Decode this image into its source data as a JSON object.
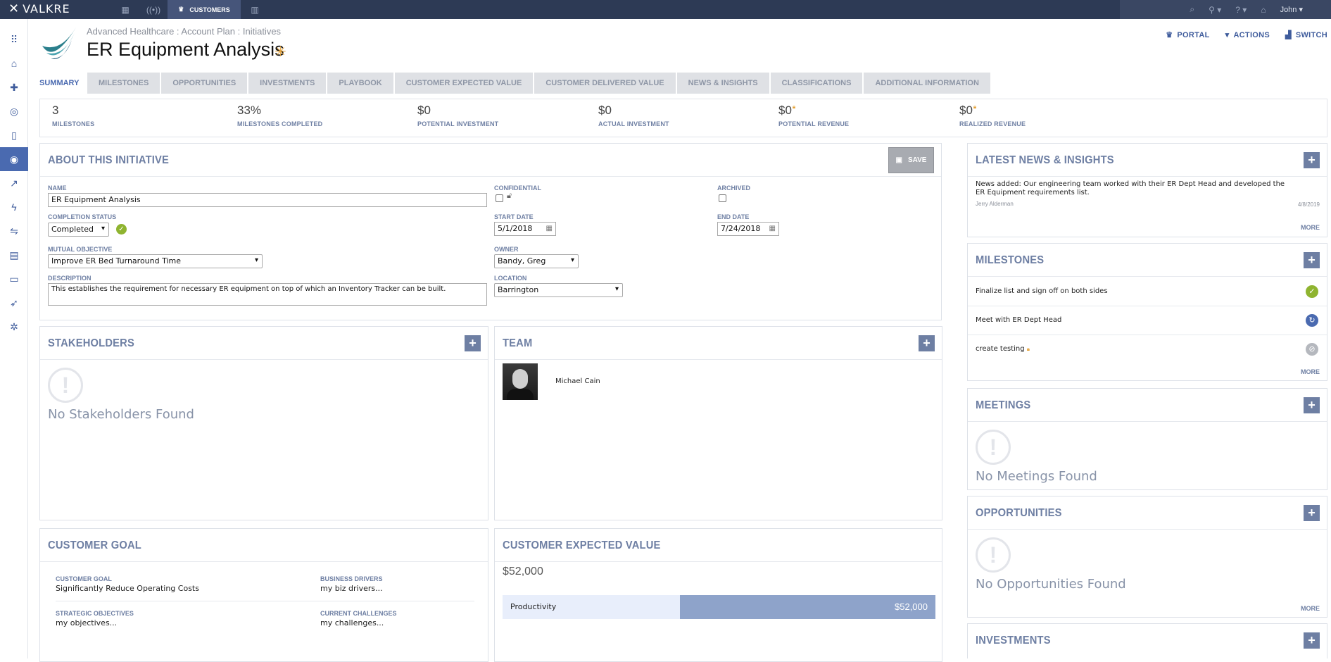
{
  "topbar": {
    "brand": "VALKRE",
    "active_nav": "CUSTOMERS",
    "user": "John"
  },
  "header": {
    "breadcrumb": "Advanced Healthcare : Account Plan : Initiatives",
    "title": "ER Equipment Analysis",
    "actions": [
      "PORTAL",
      "ACTIONS",
      "SWITCH"
    ]
  },
  "tabs": [
    "SUMMARY",
    "MILESTONES",
    "OPPORTUNITIES",
    "INVESTMENTS",
    "PLAYBOOK",
    "CUSTOMER EXPECTED VALUE",
    "CUSTOMER DELIVERED VALUE",
    "NEWS & INSIGHTS",
    "CLASSIFICATIONS",
    "ADDITIONAL INFORMATION"
  ],
  "stats": [
    {
      "value": "3",
      "label": "MILESTONES"
    },
    {
      "value": "33%",
      "label": "MILESTONES COMPLETED"
    },
    {
      "value": "$0",
      "label": "POTENTIAL INVESTMENT"
    },
    {
      "value": "$0",
      "label": "ACTUAL INVESTMENT"
    },
    {
      "value": "$0",
      "label": "POTENTIAL REVENUE"
    },
    {
      "value": "$0",
      "label": "REALIZED REVENUE"
    }
  ],
  "about": {
    "title": "ABOUT THIS INITIATIVE",
    "save": "SAVE",
    "name_label": "NAME",
    "name_value": "ER Equipment Analysis",
    "confidential_label": "CONFIDENTIAL",
    "archived_label": "ARCHIVED",
    "completion_label": "COMPLETION STATUS",
    "completion_value": "Completed",
    "start_label": "START DATE",
    "start_value": "5/1/2018",
    "end_label": "END DATE",
    "end_value": "7/24/2018",
    "objective_label": "MUTUAL OBJECTIVE",
    "objective_value": "Improve ER Bed Turnaround Time",
    "owner_label": "OWNER",
    "owner_value": "Bandy, Greg",
    "description_label": "DESCRIPTION",
    "description_value": "This establishes the requirement for necessary ER equipment on top of which an Inventory Tracker can be built.",
    "location_label": "LOCATION",
    "location_value": "Barrington"
  },
  "stakeholders": {
    "title": "STAKEHOLDERS",
    "empty": "No Stakeholders Found"
  },
  "team": {
    "title": "TEAM",
    "member": "Michael Cain"
  },
  "customer_goal": {
    "title": "CUSTOMER GOAL",
    "goal_label": "CUSTOMER GOAL",
    "goal_value": "Significantly Reduce Operating Costs",
    "drivers_label": "BUSINESS DRIVERS",
    "drivers_value": "my biz drivers...",
    "objectives_label": "STRATEGIC OBJECTIVES",
    "objectives_value": "my objectives...",
    "challenges_label": "CURRENT CHALLENGES",
    "challenges_value": "my challenges..."
  },
  "cev": {
    "title": "CUSTOMER EXPECTED VALUE",
    "total": "$52,000",
    "row_label": "Productivity",
    "row_value": "$52,000",
    "row_fraction": 0.59
  },
  "news": {
    "title": "LATEST NEWS & INSIGHTS",
    "text": "News added: Our engineering team worked with their ER Dept Head and developed the ER Equipment requirements list.",
    "author": "Jerry Alderman",
    "date": "4/8/2019",
    "more": "MORE"
  },
  "milestones": {
    "title": "MILESTONES",
    "items": [
      {
        "text": "Finalize list and sign off on both sides",
        "status": "complete"
      },
      {
        "text": "Meet with ER Dept Head",
        "status": "in-progress"
      },
      {
        "text": "create testing",
        "status": "cancelled"
      }
    ],
    "more": "MORE"
  },
  "meetings": {
    "title": "MEETINGS",
    "empty": "No Meetings Found"
  },
  "opportunities": {
    "title": "OPPORTUNITIES",
    "empty": "No Opportunities Found",
    "more": "MORE"
  },
  "investments": {
    "title": "INVESTMENTS"
  },
  "colors": {
    "nav": "#2d3a55",
    "accent": "#6e7fa3",
    "sidebar_active": "#4a6ab0",
    "complete": "#8fb430",
    "lock": "#e5a33a"
  }
}
